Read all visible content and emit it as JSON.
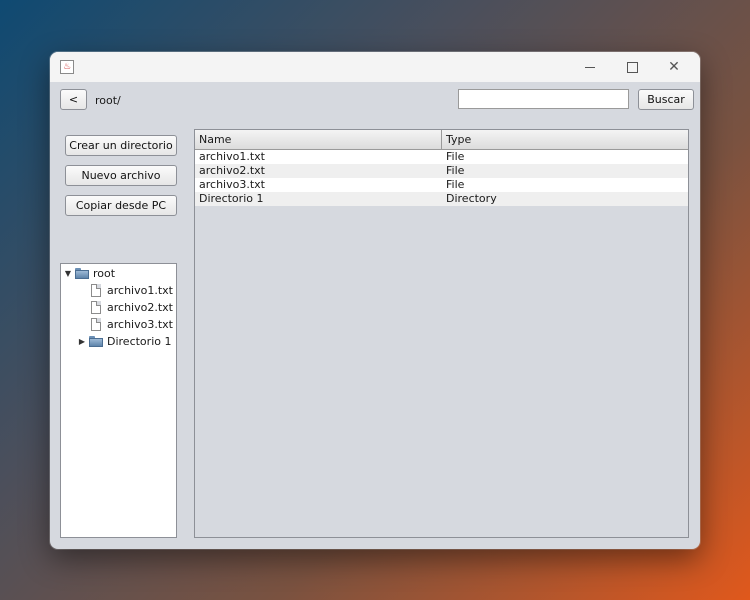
{
  "toolbar": {
    "back_label": "<",
    "path": "root/",
    "search_value": "",
    "search_button": "Buscar"
  },
  "actions": {
    "create_dir": "Crear un directorio",
    "new_file": "Nuevo archivo",
    "copy_from_pc": "Copiar desde PC"
  },
  "tree": {
    "root": "root",
    "children": [
      "archivo1.txt",
      "archivo2.txt",
      "archivo3.txt",
      "Directorio 1"
    ]
  },
  "table": {
    "headers": [
      "Name",
      "Type"
    ],
    "rows": [
      {
        "name": "archivo1.txt",
        "type": "File"
      },
      {
        "name": "archivo2.txt",
        "type": "File"
      },
      {
        "name": "archivo3.txt",
        "type": "File"
      },
      {
        "name": "Directorio 1",
        "type": "Directory"
      }
    ]
  },
  "window_controls": {
    "minimize_icon": "minimize-icon",
    "maximize_icon": "maximize-icon",
    "close_icon": "close-icon",
    "close_glyph": "✕"
  }
}
